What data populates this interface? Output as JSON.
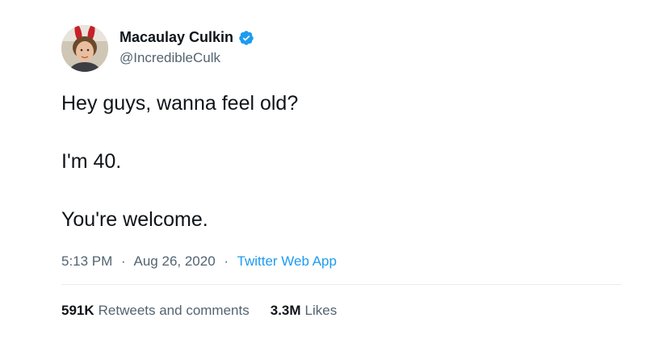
{
  "author": {
    "display_name": "Macaulay Culkin",
    "handle": "@IncredibleCulk",
    "verified": true,
    "avatar_icon": "avatar-photo"
  },
  "tweet": {
    "lines": [
      "Hey guys, wanna feel old?",
      "I'm 40.",
      "You're welcome."
    ]
  },
  "meta": {
    "time": "5:13 PM",
    "separator": "·",
    "date": "Aug 26, 2020",
    "source": "Twitter Web App"
  },
  "stats": {
    "retweets_count": "591K",
    "retweets_label": "Retweets and comments",
    "likes_count": "3.3M",
    "likes_label": "Likes"
  },
  "colors": {
    "accent": "#1d9bf0",
    "text": "#0f1419",
    "secondary_text": "#536471",
    "divider": "#e6ecf0"
  },
  "icons": {
    "verified": "verified-badge-icon"
  }
}
